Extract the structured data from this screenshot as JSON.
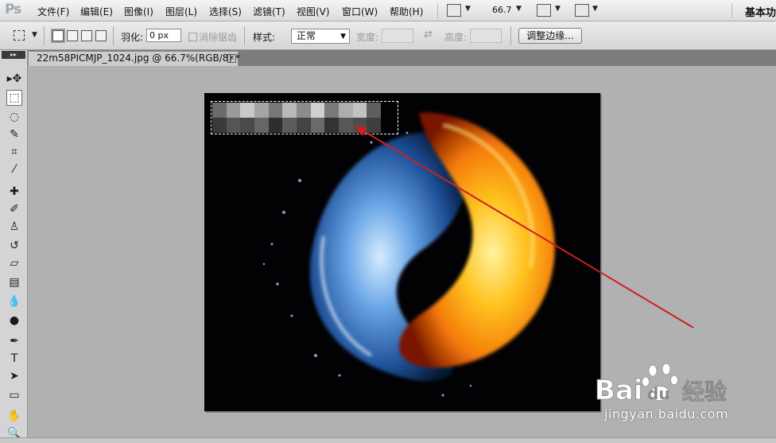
{
  "app": {
    "logo": "Ps"
  },
  "menu": {
    "items": [
      "文件(F)",
      "编辑(E)",
      "图像(I)",
      "图层(L)",
      "选择(S)",
      "滤镜(T)",
      "视图(V)",
      "窗口(W)",
      "帮助(H)"
    ],
    "zoom": "66.7",
    "workspace": "基本功"
  },
  "options": {
    "feather_label": "羽化:",
    "feather_value": "0 px",
    "antialias_label": "消除锯齿",
    "style_label": "样式:",
    "style_value": "正常",
    "width_label": "宽度:",
    "height_label": "高度:",
    "refine_edge": "调整边缘..."
  },
  "document": {
    "tab_title": "22m58PICMJP_1024.jpg @ 66.7%(RGB/8) *",
    "close_glyph": "×"
  },
  "toolbar": {
    "grip": "▸▸",
    "tools": [
      {
        "name": "move-tool",
        "glyph": "▸✥",
        "active": false
      },
      {
        "name": "rectangular-marquee-tool",
        "glyph": "⬚",
        "active": true
      },
      {
        "name": "lasso-tool",
        "glyph": "◌",
        "active": false
      },
      {
        "name": "quick-selection-tool",
        "glyph": "✎",
        "active": false
      },
      {
        "name": "crop-tool",
        "glyph": "⌗",
        "active": false
      },
      {
        "name": "eyedropper-tool",
        "glyph": "⁄",
        "active": false
      },
      {
        "name": "healing-brush-tool",
        "glyph": "✚",
        "active": false
      },
      {
        "name": "brush-tool",
        "glyph": "✐",
        "active": false
      },
      {
        "name": "clone-stamp-tool",
        "glyph": "♙",
        "active": false
      },
      {
        "name": "history-brush-tool",
        "glyph": "↺",
        "active": false
      },
      {
        "name": "eraser-tool",
        "glyph": "▱",
        "active": false
      },
      {
        "name": "gradient-tool",
        "glyph": "▤",
        "active": false
      },
      {
        "name": "blur-tool",
        "glyph": "💧",
        "active": false
      },
      {
        "name": "dodge-tool",
        "glyph": "●",
        "active": false
      },
      {
        "name": "pen-tool",
        "glyph": "✒",
        "active": false
      },
      {
        "name": "type-tool",
        "glyph": "T",
        "active": false
      },
      {
        "name": "path-selection-tool",
        "glyph": "➤",
        "active": false
      },
      {
        "name": "shape-tool",
        "glyph": "▭",
        "active": false
      },
      {
        "name": "hand-tool",
        "glyph": "✋",
        "active": false
      },
      {
        "name": "zoom-tool",
        "glyph": "🔍",
        "active": false
      }
    ]
  },
  "watermark": {
    "logo_text": "Bai",
    "logo_text_2": "du",
    "logo_cn": "经验",
    "url": "jingyan.baidu.com"
  },
  "colors": {
    "accent_arrow": "#cc1f24",
    "fire": "#ff9a10",
    "water": "#3f7ec9"
  }
}
